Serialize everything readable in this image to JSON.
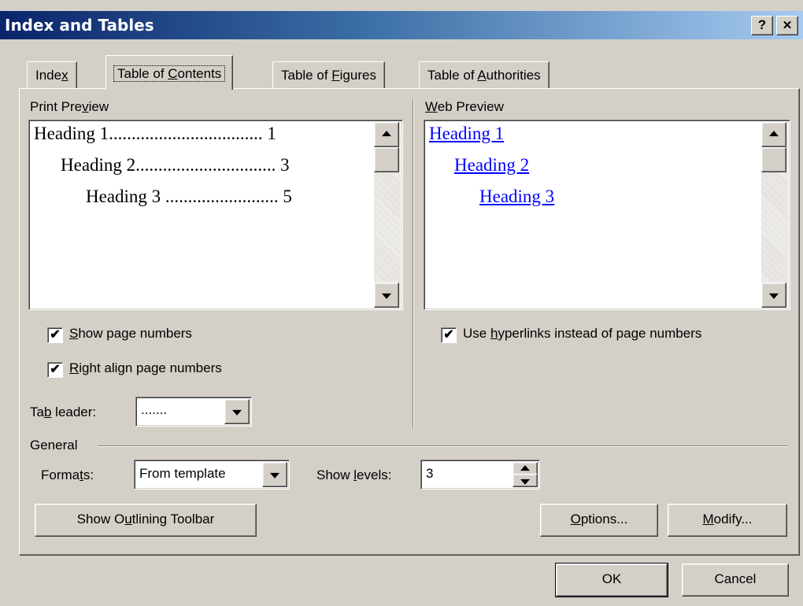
{
  "window": {
    "title": "Index and Tables",
    "help_glyph": "?",
    "close_glyph": "✕"
  },
  "tabs": [
    {
      "pre": "Inde",
      "key": "x",
      "post": ""
    },
    {
      "pre": "Table of ",
      "key": "C",
      "post": "ontents"
    },
    {
      "pre": "Table of ",
      "key": "F",
      "post": "igures"
    },
    {
      "pre": "Table of ",
      "key": "A",
      "post": "uthorities"
    }
  ],
  "print_preview": {
    "label_pre": "Print Pre",
    "label_key": "v",
    "label_post": "iew",
    "lines": [
      "Heading 1.................................. 1",
      "Heading 2............................... 3",
      "Heading 3 ......................... 5"
    ]
  },
  "web_preview": {
    "label_key": "W",
    "label_post": "eb Preview",
    "lines": [
      "Heading 1",
      "Heading 2",
      "Heading 3"
    ]
  },
  "options": {
    "show_page_numbers": {
      "key": "S",
      "post": "how page numbers",
      "checked": true
    },
    "right_align": {
      "key": "R",
      "post": "ight align page numbers",
      "checked": true
    },
    "use_hyperlinks": {
      "pre": "Use ",
      "key": "h",
      "post": "yperlinks instead of page numbers",
      "checked": true
    },
    "tab_leader": {
      "pre": "Ta",
      "key": "b",
      "post": " leader:",
      "value": "......."
    }
  },
  "general": {
    "title": "General",
    "formats_pre": "Forma",
    "formats_key": "t",
    "formats_post": "s:",
    "formats_value": "From template",
    "levels_pre": "Show ",
    "levels_key": "l",
    "levels_post": "evels:",
    "levels_value": "3"
  },
  "buttons": {
    "outline_pre": "Show O",
    "outline_key": "u",
    "outline_post": "tlining Toolbar",
    "options_key": "O",
    "options_post": "ptions...",
    "modify_key": "M",
    "modify_post": "odify...",
    "ok": "OK",
    "cancel": "Cancel"
  },
  "check_glyph": "✔"
}
